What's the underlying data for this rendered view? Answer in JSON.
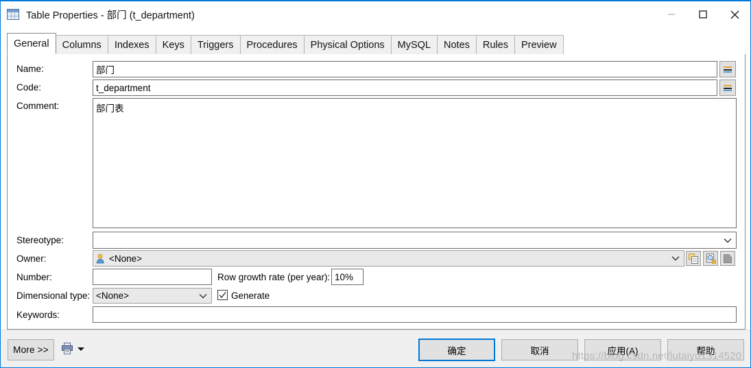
{
  "window": {
    "title": "Table Properties - 部门 (t_department)",
    "icon": "table-grid-icon",
    "accent_color": "#0078d7",
    "controls": {
      "minimize": "minimize-icon",
      "maximize": "maximize-icon",
      "close": "close-icon"
    }
  },
  "tabs": [
    {
      "label": "General",
      "active": true
    },
    {
      "label": "Columns",
      "active": false
    },
    {
      "label": "Indexes",
      "active": false
    },
    {
      "label": "Keys",
      "active": false
    },
    {
      "label": "Triggers",
      "active": false
    },
    {
      "label": "Procedures",
      "active": false
    },
    {
      "label": "Physical Options",
      "active": false
    },
    {
      "label": "MySQL",
      "active": false
    },
    {
      "label": "Notes",
      "active": false
    },
    {
      "label": "Rules",
      "active": false
    },
    {
      "label": "Preview",
      "active": false
    }
  ],
  "form": {
    "name": {
      "label": "Name:",
      "value": "部门"
    },
    "code": {
      "label": "Code:",
      "value": "t_department"
    },
    "comment": {
      "label": "Comment:",
      "value": "部门表"
    },
    "stereotype": {
      "label": "Stereotype:",
      "value": ""
    },
    "owner": {
      "label": "Owner:",
      "value": "<None>"
    },
    "number": {
      "label": "Number:",
      "value": ""
    },
    "row_growth_rate": {
      "label": "Row growth rate (per year):",
      "value": "10%"
    },
    "dimensional_type": {
      "label": "Dimensional type:",
      "value": "<None>"
    },
    "generate": {
      "label": "Generate",
      "checked": true
    },
    "keywords": {
      "label": "Keywords:",
      "value": ""
    }
  },
  "footer": {
    "more": "More >>",
    "report_icon": "report-icon",
    "report_dropdown": "dropdown-arrow-icon",
    "ok": "确定",
    "cancel": "取消",
    "apply": "应用(A)",
    "help": "帮助"
  },
  "watermark": "https://blog.csdn.net/lutaiyu1314520"
}
